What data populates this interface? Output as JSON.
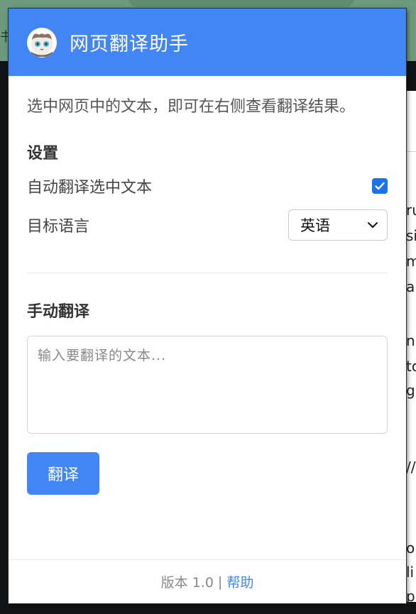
{
  "background": {
    "edge_char": "书",
    "page_fragments": [
      "ru",
      "si",
      "m",
      "a",
      "n",
      "to",
      "gu",
      "//",
      "or",
      "li",
      "p"
    ]
  },
  "popup": {
    "title": "网页翻译助手",
    "logo_icon": "cat-mascot-icon",
    "description": "选中网页中的文本，即可在右侧查看翻译结果。",
    "settings": {
      "heading": "设置",
      "auto_translate_label": "自动翻译选中文本",
      "auto_translate_checked": true,
      "target_language_label": "目标语言",
      "target_language_value": "英语"
    },
    "manual": {
      "heading": "手动翻译",
      "input_placeholder": "输入要翻译的文本...",
      "translate_button": "翻译"
    },
    "footer": {
      "version": "版本 1.0",
      "separator": "|",
      "help_link": "帮助"
    }
  },
  "colors": {
    "accent": "#4285f4",
    "checkbox": "#1a73e8"
  }
}
